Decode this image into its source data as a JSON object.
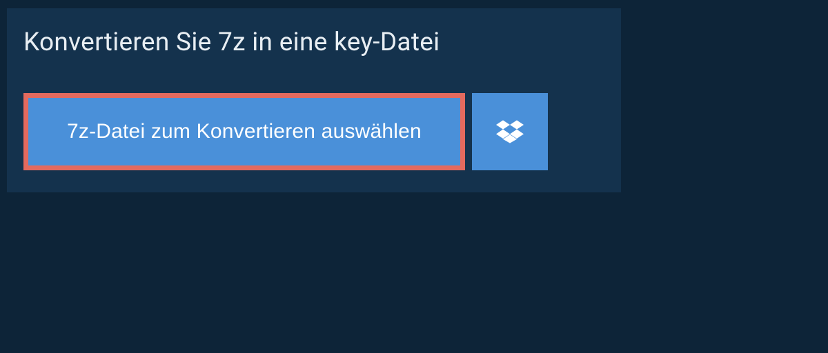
{
  "header": {
    "title": "Konvertieren Sie 7z in eine key-Datei"
  },
  "actions": {
    "select_file_label": "7z-Datei zum Konvertieren auswählen"
  },
  "colors": {
    "page_bg": "#0d2438",
    "panel_bg": "#14324d",
    "button_bg": "#4a90d9",
    "highlight_border": "#e46a5e",
    "text_light": "#e8eef3",
    "text_white": "#ffffff"
  },
  "icons": {
    "dropbox": "dropbox-icon"
  }
}
